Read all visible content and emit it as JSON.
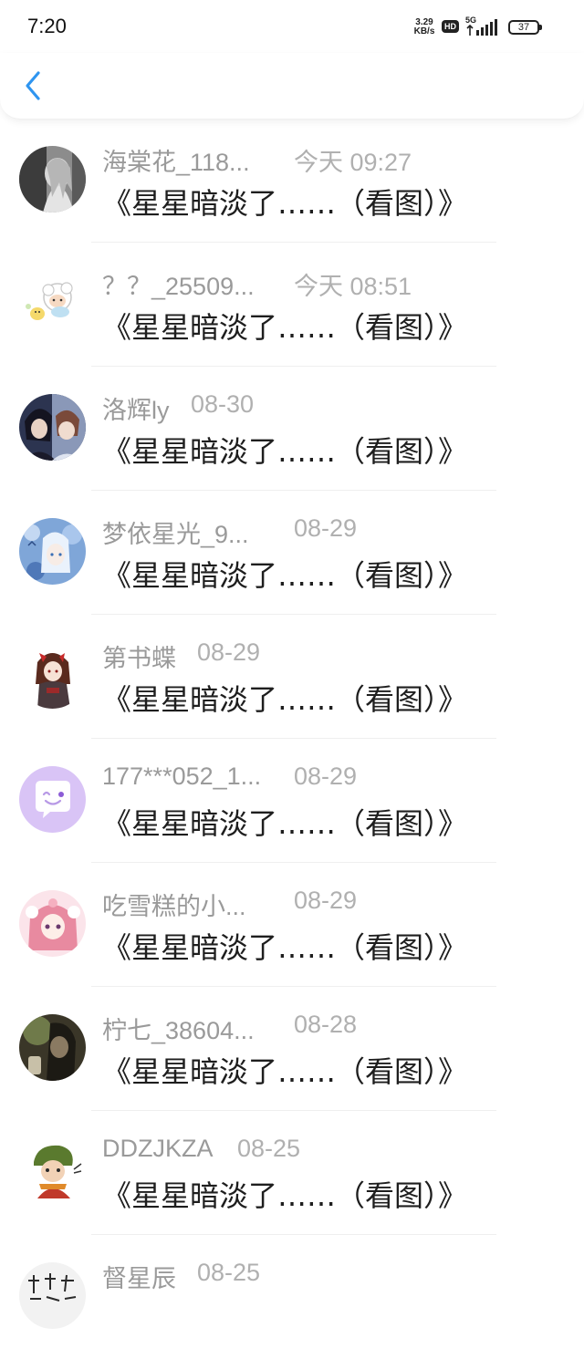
{
  "status_bar": {
    "time": "7:20",
    "net_speed_value": "3.29",
    "net_speed_unit": "KB/s",
    "hd_label": "HD",
    "network_label": "5G",
    "battery_level": "37"
  },
  "header": {
    "back_icon": "chevron-left-icon",
    "accent_color": "#2f95f0"
  },
  "comments": [
    {
      "username": "海棠花_118...",
      "time": "今天 09:27",
      "title": "《星星暗淡了……（看图）》",
      "avatar": "avatar-gray-sketch"
    },
    {
      "username": "？？_25509...",
      "time": "今天 08:51",
      "title": "《星星暗淡了……（看图）》",
      "avatar": "avatar-cartoon-sheep"
    },
    {
      "username": "洛辉ly",
      "time": "08-30",
      "title": "《星星暗淡了……（看图）》",
      "avatar": "avatar-anime-duo"
    },
    {
      "username": "梦依星光_9...",
      "time": "08-29",
      "title": "《星星暗淡了……（看图）》",
      "avatar": "avatar-blue-anime"
    },
    {
      "username": "第书蝶",
      "time": "08-29",
      "title": "《星星暗淡了……（看图）》",
      "avatar": "avatar-anime-girl"
    },
    {
      "username": "177***052_1...",
      "time": "08-29",
      "title": "《星星暗淡了……（看图）》",
      "avatar": "avatar-default-purple"
    },
    {
      "username": "吃雪糕的小...",
      "time": "08-29",
      "title": "《星星暗淡了……（看图）》",
      "avatar": "avatar-pink-anime"
    },
    {
      "username": "柠七_38604...",
      "time": "08-28",
      "title": "《星星暗淡了……（看图）》",
      "avatar": "avatar-dark-photo"
    },
    {
      "username": "DDZJKZA",
      "time": "08-25",
      "title": "《星星暗淡了……（看图）》",
      "avatar": "avatar-green-cartoon"
    },
    {
      "username": "督星辰",
      "time": "08-25",
      "title": "",
      "avatar": "avatar-calligraphy"
    }
  ]
}
